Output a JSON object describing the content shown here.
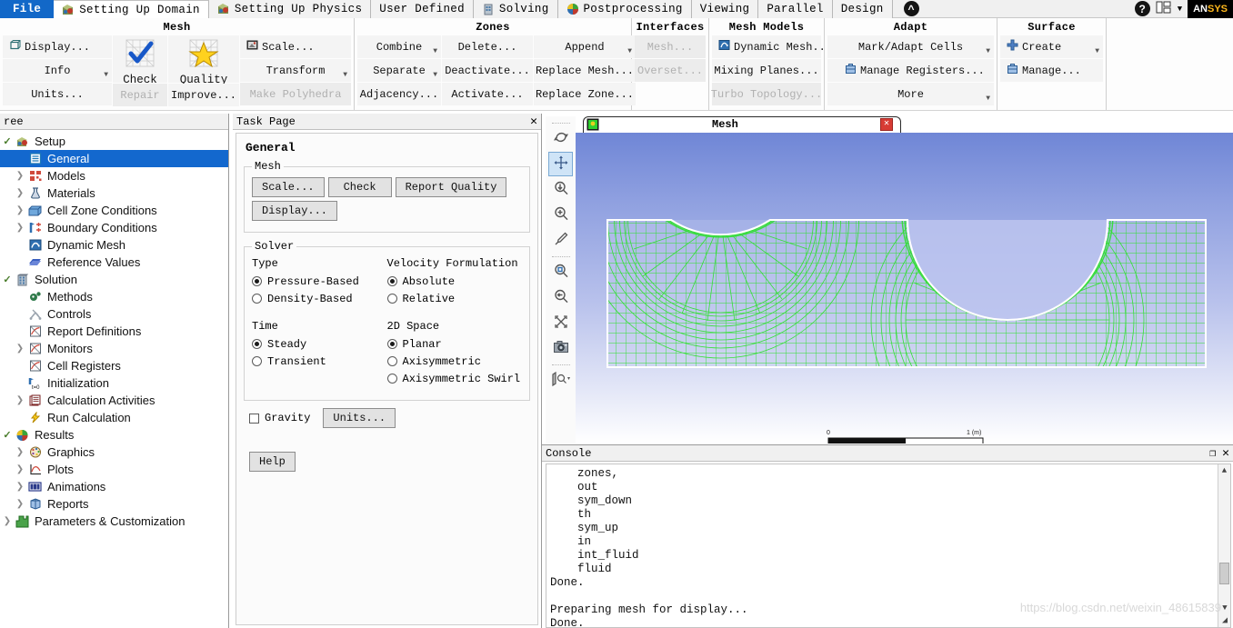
{
  "ribbon_tabs": [
    {
      "label": "File",
      "icon": "none",
      "kind": "file"
    },
    {
      "label": "Setting Up Domain",
      "icon": "domain-icon",
      "kind": "active"
    },
    {
      "label": "Setting Up Physics",
      "icon": "physics-icon",
      "kind": "normal"
    },
    {
      "label": "User Defined",
      "icon": "none",
      "kind": "normal"
    },
    {
      "label": "Solving",
      "icon": "solving-icon",
      "kind": "normal"
    },
    {
      "label": "Postprocessing",
      "icon": "postprocessing-icon",
      "kind": "normal"
    },
    {
      "label": "Viewing",
      "icon": "none",
      "kind": "normal"
    },
    {
      "label": "Parallel",
      "icon": "none",
      "kind": "normal"
    },
    {
      "label": "Design",
      "icon": "none",
      "kind": "normal"
    }
  ],
  "tabbar_right": {
    "collapse_icon": "chevron-up-icon",
    "help_icon": "help-icon",
    "layout_icon": "layout-icon",
    "caret_icon": "chevron-down-icon",
    "brand": "ANSYS",
    "brand_prefix": "AN",
    "brand_suffix": "SYS"
  },
  "ribbon_groups": [
    {
      "title": "Mesh",
      "columns": [
        {
          "buttons": [
            {
              "label": "Display...",
              "icon": "cube-display-icon",
              "state": "normal",
              "caret": false
            },
            {
              "label": "Info",
              "icon": "none",
              "state": "normal",
              "caret": true
            },
            {
              "label": "Units...",
              "icon": "none",
              "state": "normal",
              "caret": false
            }
          ]
        },
        {
          "buttons": [
            {
              "label": "Check",
              "icon": "check-mesh-icon",
              "state": "big",
              "caret": false
            },
            {
              "label": "Repair",
              "icon": "none",
              "state": "disabled",
              "caret": false
            }
          ]
        },
        {
          "buttons": [
            {
              "label": "Quality",
              "icon": "quality-star-icon",
              "state": "big",
              "caret": false
            },
            {
              "label": "Improve...",
              "icon": "none",
              "state": "normal",
              "caret": false
            }
          ]
        },
        {
          "buttons": [
            {
              "label": "Scale...",
              "icon": "scale-icon",
              "state": "normal",
              "caret": false
            },
            {
              "label": "Transform",
              "icon": "none",
              "state": "normal",
              "caret": true
            },
            {
              "label": "Make Polyhedra",
              "icon": "none",
              "state": "disabled",
              "caret": false
            }
          ]
        }
      ]
    },
    {
      "title": "Zones",
      "columns": [
        {
          "buttons": [
            {
              "label": "Combine",
              "icon": "none",
              "state": "normal",
              "caret": true
            },
            {
              "label": "Separate",
              "icon": "none",
              "state": "normal",
              "caret": true
            },
            {
              "label": "Adjacency...",
              "icon": "none",
              "state": "normal",
              "caret": false
            }
          ]
        },
        {
          "buttons": [
            {
              "label": "Delete...",
              "icon": "none",
              "state": "normal",
              "caret": false
            },
            {
              "label": "Deactivate...",
              "icon": "none",
              "state": "normal",
              "caret": false
            },
            {
              "label": "Activate...",
              "icon": "none",
              "state": "normal",
              "caret": false
            }
          ]
        },
        {
          "buttons": [
            {
              "label": "Append",
              "icon": "none",
              "state": "normal",
              "caret": true
            },
            {
              "label": "Replace Mesh...",
              "icon": "none",
              "state": "normal",
              "caret": false
            },
            {
              "label": "Replace Zone...",
              "icon": "none",
              "state": "normal",
              "caret": false
            }
          ]
        }
      ]
    },
    {
      "title": "Interfaces",
      "columns": [
        {
          "buttons": [
            {
              "label": "Mesh...",
              "icon": "none",
              "state": "disabled",
              "caret": false
            },
            {
              "label": "Overset...",
              "icon": "none",
              "state": "disabled",
              "caret": false
            }
          ]
        }
      ]
    },
    {
      "title": "Mesh Models",
      "columns": [
        {
          "buttons": [
            {
              "label": "Dynamic Mesh...",
              "icon": "dynamic-mesh-icon",
              "state": "normal",
              "caret": false
            },
            {
              "label": "Mixing Planes...",
              "icon": "none",
              "state": "normal",
              "caret": false
            },
            {
              "label": "Turbo Topology...",
              "icon": "none",
              "state": "disabled",
              "caret": false
            }
          ]
        }
      ]
    },
    {
      "title": "Adapt",
      "columns": [
        {
          "buttons": [
            {
              "label": "Mark/Adapt Cells",
              "icon": "none",
              "state": "normal",
              "caret": true
            },
            {
              "label": "Manage Registers...",
              "icon": "register-icon",
              "state": "normal",
              "caret": false
            },
            {
              "label": "More",
              "icon": "none",
              "state": "normal",
              "caret": true
            }
          ]
        }
      ]
    },
    {
      "title": "Surface",
      "columns": [
        {
          "buttons": [
            {
              "label": "Create",
              "icon": "plus-icon",
              "state": "normal",
              "caret": true
            },
            {
              "label": "Manage...",
              "icon": "register-icon",
              "state": "normal",
              "caret": false
            }
          ]
        }
      ]
    }
  ],
  "tree": {
    "header": "ree",
    "nodes": [
      {
        "label": "Setup",
        "depth": 0,
        "icon": "setup-icon",
        "twisty": "check",
        "selected": false
      },
      {
        "label": "General",
        "depth": 1,
        "icon": "general-icon",
        "twisty": "none",
        "selected": true
      },
      {
        "label": "Models",
        "depth": 1,
        "icon": "models-icon",
        "twisty": "arrow",
        "selected": false
      },
      {
        "label": "Materials",
        "depth": 1,
        "icon": "materials-icon",
        "twisty": "arrow",
        "selected": false
      },
      {
        "label": "Cell Zone Conditions",
        "depth": 1,
        "icon": "cellzone-icon",
        "twisty": "arrow",
        "selected": false
      },
      {
        "label": "Boundary Conditions",
        "depth": 1,
        "icon": "boundary-icon",
        "twisty": "arrow",
        "selected": false
      },
      {
        "label": "Dynamic Mesh",
        "depth": 1,
        "icon": "dynamic-mesh-icon",
        "twisty": "none",
        "selected": false
      },
      {
        "label": "Reference Values",
        "depth": 1,
        "icon": "reference-icon",
        "twisty": "none",
        "selected": false
      },
      {
        "label": "Solution",
        "depth": 0,
        "icon": "solution-icon",
        "twisty": "check",
        "selected": false
      },
      {
        "label": "Methods",
        "depth": 1,
        "icon": "methods-icon",
        "twisty": "none",
        "selected": false
      },
      {
        "label": "Controls",
        "depth": 1,
        "icon": "controls-icon",
        "twisty": "none",
        "selected": false
      },
      {
        "label": "Report Definitions",
        "depth": 1,
        "icon": "report-icon",
        "twisty": "none",
        "selected": false
      },
      {
        "label": "Monitors",
        "depth": 1,
        "icon": "report-icon",
        "twisty": "arrow",
        "selected": false
      },
      {
        "label": "Cell Registers",
        "depth": 1,
        "icon": "report-icon",
        "twisty": "none",
        "selected": false
      },
      {
        "label": "Initialization",
        "depth": 1,
        "icon": "initialization-icon",
        "twisty": "none",
        "selected": false
      },
      {
        "label": "Calculation Activities",
        "depth": 1,
        "icon": "calcactivities-icon",
        "twisty": "arrow",
        "selected": false
      },
      {
        "label": "Run Calculation",
        "depth": 1,
        "icon": "run-calculation-icon",
        "twisty": "none",
        "selected": false
      },
      {
        "label": "Results",
        "depth": 0,
        "icon": "results-icon",
        "twisty": "check",
        "selected": false
      },
      {
        "label": "Graphics",
        "depth": 1,
        "icon": "graphics-icon",
        "twisty": "arrow",
        "selected": false
      },
      {
        "label": "Plots",
        "depth": 1,
        "icon": "plots-icon",
        "twisty": "arrow",
        "selected": false
      },
      {
        "label": "Animations",
        "depth": 1,
        "icon": "animations-icon",
        "twisty": "arrow",
        "selected": false
      },
      {
        "label": "Reports",
        "depth": 1,
        "icon": "reports-icon",
        "twisty": "arrow",
        "selected": false
      },
      {
        "label": "Parameters & Customization",
        "depth": 0,
        "icon": "parameters-icon",
        "twisty": "arrow",
        "selected": false
      }
    ]
  },
  "task_page": {
    "header": "Task Page",
    "close_icon": "close-icon",
    "title": "General",
    "mesh_group": {
      "legend": "Mesh",
      "buttons": [
        "Scale...",
        "Check",
        "Report Quality",
        "Display..."
      ]
    },
    "solver_group": {
      "legend": "Solver",
      "type": {
        "label": "Type",
        "options": [
          "Pressure-Based",
          "Density-Based"
        ],
        "selected": "Pressure-Based"
      },
      "velocity_formulation": {
        "label": "Velocity Formulation",
        "options": [
          "Absolute",
          "Relative"
        ],
        "selected": "Absolute"
      },
      "time": {
        "label": "Time",
        "options": [
          "Steady",
          "Transient"
        ],
        "selected": "Steady"
      },
      "two_d_space": {
        "label": "2D Space",
        "options": [
          "Planar",
          "Axisymmetric",
          "Axisymmetric Swirl"
        ],
        "selected": "Planar"
      }
    },
    "gravity": {
      "label": "Gravity",
      "checked": false
    },
    "units_button": "Units...",
    "help_button": "Help"
  },
  "graphics_toolbar": {
    "items": [
      {
        "icon": "refresh-icon",
        "active": false
      },
      {
        "icon": "pan-move-icon",
        "active": true
      },
      {
        "icon": "zoom-fit-icon",
        "active": false
      },
      {
        "icon": "zoom-in-icon",
        "active": false
      },
      {
        "icon": "probe-picker-icon",
        "active": false
      },
      {
        "icon": "zoom-region-icon",
        "active": false
      },
      {
        "icon": "zoom-out-icon",
        "active": false
      },
      {
        "icon": "fit-to-window-icon",
        "active": false
      },
      {
        "icon": "camera-icon",
        "active": false
      },
      {
        "icon": "display-options-icon",
        "active": false
      }
    ]
  },
  "graphics_window": {
    "tab_title": "Mesh",
    "tab_icon": "mesh-window-icon",
    "close_icon": "close-icon",
    "scale_bar": {
      "min": "0",
      "max": "1 (m)"
    }
  },
  "console": {
    "header": "Console",
    "restore_icon": "restore-icon",
    "close_icon": "close-icon",
    "lines": "    zones,\n    out\n    sym_down\n    th\n    sym_up\n    in\n    int_fluid\n    fluid\nDone.\n\nPreparing mesh for display...\nDone.",
    "scroll_up_icon": "chevron-up-icon",
    "scroll_down_icon": "chevron-down-icon"
  },
  "watermark": "https://blog.csdn.net/weixin_48615839",
  "colors": {
    "accent_blue": "#1368ce",
    "file_tab": "#1268c8",
    "mesh_green": "#22cc22",
    "brand_gold": "#ffb81c",
    "close_red": "#d73b34"
  }
}
